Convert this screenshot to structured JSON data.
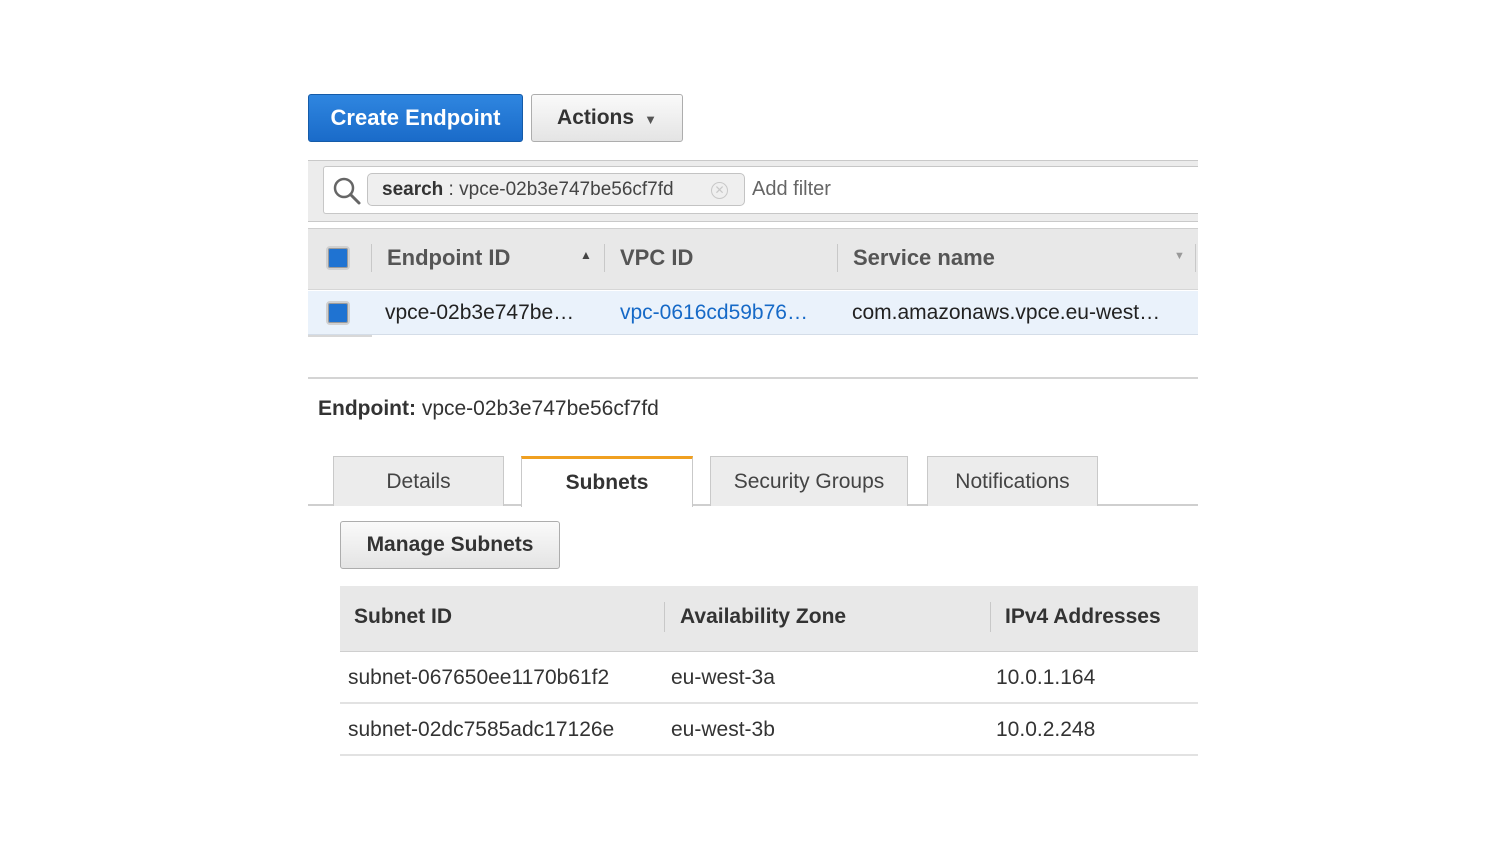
{
  "toolbar": {
    "create_label": "Create Endpoint",
    "actions_label": "Actions"
  },
  "search": {
    "token_key": "search",
    "token_sep": " : ",
    "token_value": "vpce-02b3e747be56cf7fd",
    "add_filter": "Add filter"
  },
  "endpoints_table": {
    "columns": [
      "Endpoint ID",
      "VPC ID",
      "Service name"
    ],
    "rows": [
      {
        "endpoint_id": "vpce-02b3e747be…",
        "vpc_id": "vpc-0616cd59b76…",
        "service_name": "com.amazonaws.vpce.eu-west…"
      }
    ]
  },
  "detail": {
    "label": "Endpoint:",
    "value": "vpce-02b3e747be56cf7fd"
  },
  "tabs": [
    {
      "label": "Details"
    },
    {
      "label": "Subnets"
    },
    {
      "label": "Security Groups"
    },
    {
      "label": "Notifications"
    }
  ],
  "subnets": {
    "manage_label": "Manage Subnets",
    "columns": [
      "Subnet ID",
      "Availability Zone",
      "IPv4 Addresses"
    ],
    "rows": [
      {
        "subnet_id": "subnet-067650ee1170b61f2",
        "az": "eu-west-3a",
        "ipv4": "10.0.1.164"
      },
      {
        "subnet_id": "subnet-02dc7585adc17126e",
        "az": "eu-west-3b",
        "ipv4": "10.0.2.248"
      }
    ]
  },
  "colors": {
    "primary": "#1a6bc9",
    "link": "#1569c7",
    "active_tab_accent": "#f0a020",
    "selected_row": "#eaf2fb"
  }
}
